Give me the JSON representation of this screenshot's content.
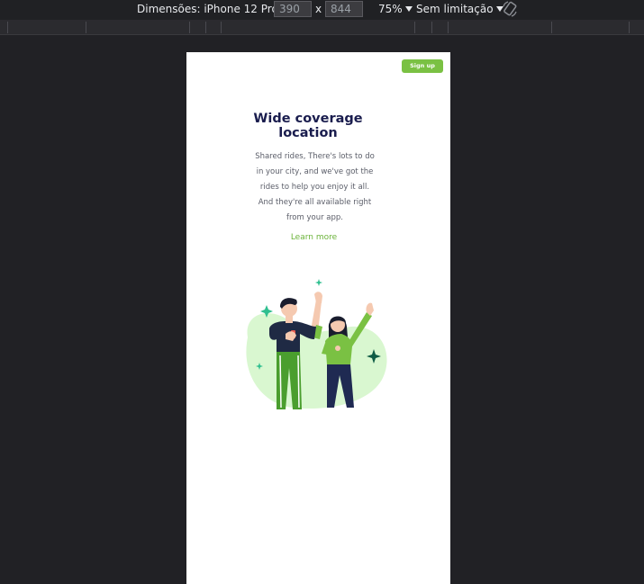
{
  "devtools": {
    "device_label": "Dimensões: iPhone 12 Pro",
    "width_value": "390",
    "height_value": "844",
    "times_sign": "x",
    "zoom": "75%",
    "throttle": "Sem limitação"
  },
  "page": {
    "signup_label": "Sign up",
    "title_lines": [
      "Wide coverage",
      "location"
    ],
    "body_lines": [
      "Shared rides, There's lots to do",
      "in your city, and we've got the",
      "rides to help you enjoy it all.",
      "And they're all available right",
      "from your app."
    ],
    "learn_more": "Learn more"
  },
  "colors": {
    "accent": "#7ac143",
    "title": "#1a1d4e",
    "blob": "#d9f7d0",
    "sparkle_dark": "#0f5c45",
    "sparkle_light": "#2fbf8f"
  },
  "icons": {
    "rotate": "rotate-icon",
    "dropdown": "triangle-down-icon"
  }
}
